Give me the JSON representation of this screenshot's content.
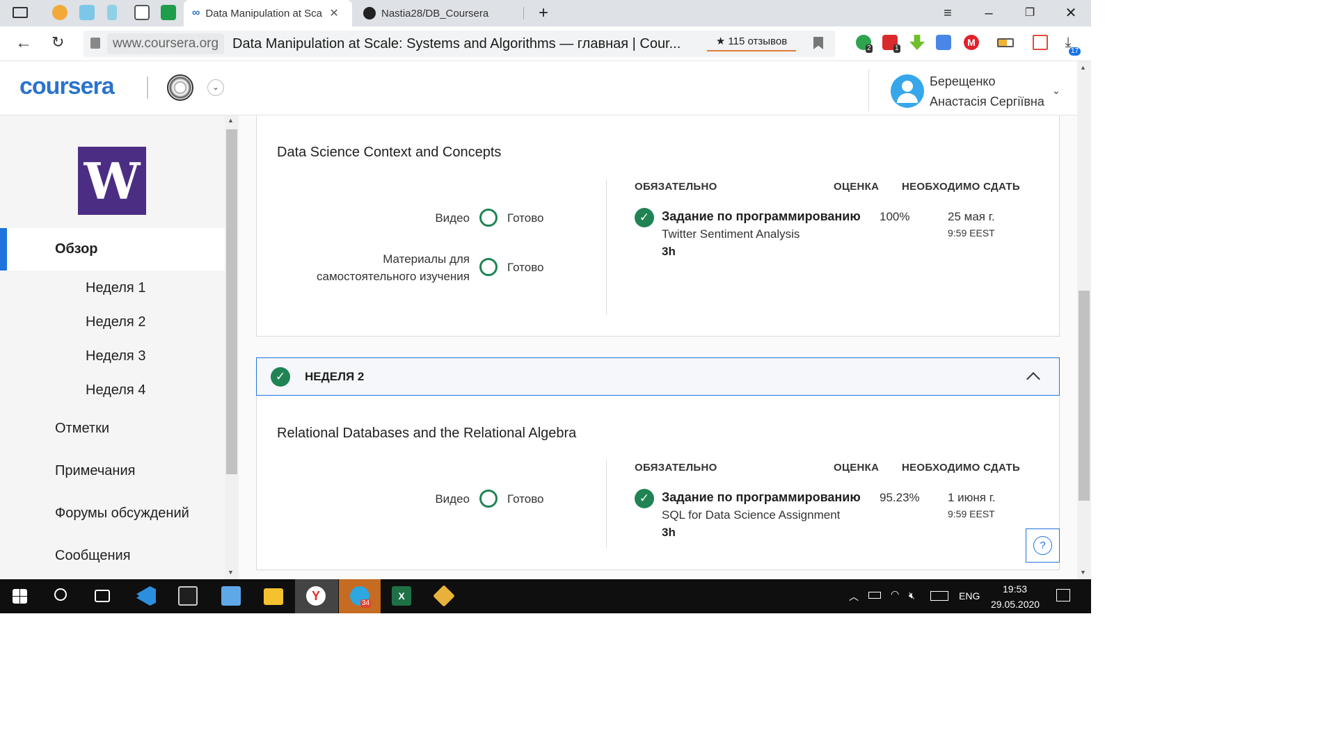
{
  "browser": {
    "tabs": [
      {
        "title": "Data Manipulation at Sca",
        "active": true
      },
      {
        "title": "Nastia28/DB_Coursera",
        "active": false
      }
    ],
    "new_tab_icon": "plus-icon",
    "url_host": "www.coursera.org",
    "page_title": "Data Manipulation at Scale: Systems and Algorithms — главная | Cour...",
    "reviews": "★ 115 отзывов",
    "extension_badges": [
      "2",
      "1",
      "17"
    ]
  },
  "header": {
    "logo": "coursera",
    "user_first": "Берещенко",
    "user_second": "Анастасія Сергіївна"
  },
  "sidebar": {
    "logo_letter": "W",
    "overview": "Обзор",
    "weeks": [
      "Неделя 1",
      "Неделя 2",
      "Неделя 3",
      "Неделя 4"
    ],
    "items": [
      "Отметки",
      "Примечания",
      "Форумы обсуждений",
      "Сообщения"
    ]
  },
  "week1": {
    "lesson_title": "Data Science Context and Concepts",
    "items": [
      {
        "label": "Видео",
        "status": "Готово"
      },
      {
        "label": "Материалы для самостоятельного изучения",
        "status": "Готово"
      }
    ],
    "col_required": "ОБЯЗАТЕЛЬНО",
    "col_grade": "ОЦЕНКА",
    "col_due": "НЕОБХОДИМО СДАТЬ",
    "assignment": {
      "type": "Задание по программированию",
      "name": "Twitter Sentiment Analysis",
      "duration": "3h",
      "grade": "100%",
      "due_date": "25 мая г.",
      "due_time": "9:59 EEST"
    }
  },
  "week2": {
    "header": "НЕДЕЛЯ 2",
    "lesson_title": "Relational Databases and the Relational Algebra",
    "items": [
      {
        "label": "Видео",
        "status": "Готово"
      }
    ],
    "col_required": "ОБЯЗАТЕЛЬНО",
    "col_grade": "ОЦЕНКА",
    "col_due": "НЕОБХОДИМО СДАТЬ",
    "assignment": {
      "type": "Задание по программированию",
      "name": "SQL for Data Science Assignment",
      "duration": "3h",
      "grade": "95.23%",
      "due_date": "1 июня г.",
      "due_time": "9:59 EEST"
    }
  },
  "help": "?",
  "taskbar": {
    "telegram_badge": "34",
    "language": "ENG",
    "time": "19:53",
    "date": "29.05.2020"
  },
  "colors": {
    "accent": "#1f73dd",
    "success": "#1f8354",
    "uw_purple": "#4b2e83",
    "coursera_blue": "#2a73cc"
  }
}
